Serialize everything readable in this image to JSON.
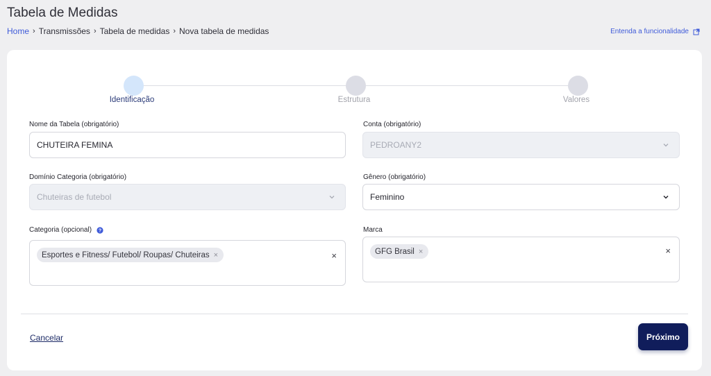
{
  "page": {
    "title": "Tabela de Medidas",
    "help_link": "Entenda a funcionalidade"
  },
  "breadcrumb": [
    "Home",
    "Transmissões",
    "Tabela de medidas",
    "Nova tabela de medidas"
  ],
  "stepper": {
    "steps": [
      {
        "label": "Identificação",
        "active": true
      },
      {
        "label": "Estrutura",
        "active": false
      },
      {
        "label": "Valores",
        "active": false
      }
    ]
  },
  "form": {
    "nome_tabela": {
      "label": "Nome da Tabela (obrigatório)",
      "value": "CHUTEIRA FEMINA"
    },
    "conta": {
      "label": "Conta (obrigatório)",
      "value": "PEDROANY2",
      "disabled": true
    },
    "dominio_categoria": {
      "label": "Domínio Categoria (obrigatório)",
      "value": "Chuteiras de futebol",
      "disabled": true
    },
    "genero": {
      "label": "Gênero (obrigatório)",
      "value": "Feminino"
    },
    "categoria": {
      "label": "Categoria (opcional)",
      "chips": [
        "Esportes e Fitness/ Futebol/ Roupas/ Chuteiras"
      ],
      "clear": "×"
    },
    "marca": {
      "label": "Marca",
      "chips": [
        "GFG Brasil"
      ],
      "clear": "×"
    }
  },
  "footer": {
    "cancel_label": "Cancelar",
    "next_label": "Próximo"
  },
  "icons": {
    "external_link": "external-link-icon",
    "info": "info-icon",
    "chevron": "chevron-down-icon",
    "chip_remove": "×"
  },
  "colors": {
    "link": "#3f5bd9",
    "primary_button": "#101d5b",
    "active_step": "#d4e6fb"
  }
}
